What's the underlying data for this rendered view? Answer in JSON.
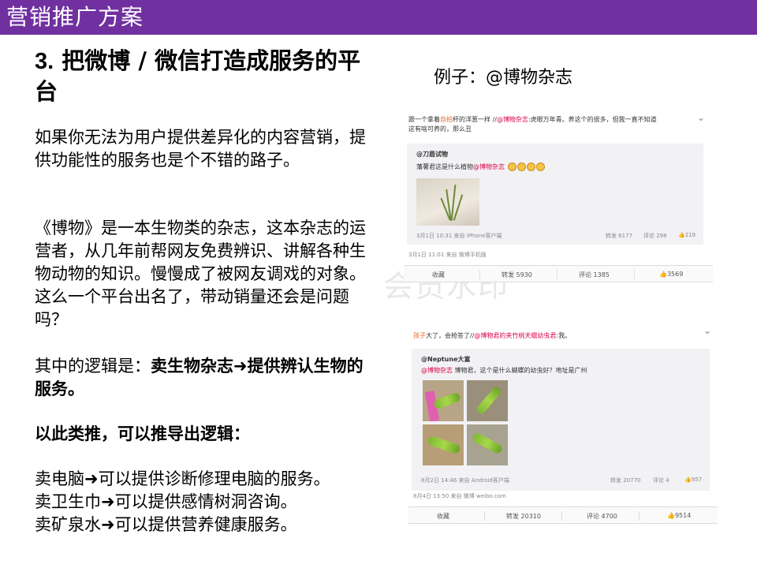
{
  "header": {
    "title": "营销推广方案"
  },
  "heading": {
    "num": "3.",
    "text": "把微博 / 微信打造成服务的平台"
  },
  "paragraphs": {
    "p1": "如果你无法为用户提供差异化的内容营销，提供功能性的服务也是个不错的路子。",
    "p2": "《博物》是一本生物类的杂志，这本杂志的运营者，从几年前帮网友免费辨识、讲解各种生物动物的知识。慢慢成了被网友调戏的对象。这么一个平台出名了，带动销量还会是问题吗？",
    "p3_prefix": "其中的逻辑是：",
    "p3_bold": "卖生物杂志➜提供辨认生物的服务。",
    "p4": "以此类推，可以推导出逻辑：",
    "p5_lines": [
      "卖电脑➜可以提供诊断修理电脑的服务。",
      "卖卫生巾➜可以提供感情树洞咨询。",
      "卖矿泉水➜可以提供营养健康服务。"
    ]
  },
  "example_label": "例子：@博物杂志",
  "watermark": "会员水印",
  "weibo1": {
    "post_pre": "跟一个拿着",
    "post_hl": "自拍",
    "post_mid": "杆的洋葱一样 //",
    "post_link": "@博物杂志",
    "post_rest": ":虎眼万年青。养这个的很多，但我一直不知道",
    "post_line2": "这有啥可养的，那么丑",
    "src_user": "@刀眉试物",
    "src_text_pre": "藩薯君这是什么植物",
    "src_text_link": "@博物杂志",
    "src_meta": "3月1日 10:31 来自 iPhone客户端",
    "src_stats": [
      "转发 6177",
      "评论 298",
      "👍218"
    ],
    "meta": "3月1日 11:01 来自 微博手机版",
    "actions": [
      "收藏",
      "转发 5930",
      "评论 1385",
      "👍3569"
    ]
  },
  "weibo2": {
    "post_hl": "孩子",
    "post_mid": "大了，会抢答了//",
    "post_link": "@博物君的夹竹桃天蛾幼虫君",
    "post_rest": ":我。",
    "src_user": "@Neptune大富",
    "src_text_link": "@博物杂志",
    "src_text_rest": "博物君，这个是什么蝴蝶的幼虫好？地址是广州",
    "src_meta": "8月2日 14:46 来自 Android客户端",
    "src_stats": [
      "转发 20770",
      "评论 4",
      "👍957"
    ],
    "meta": "8月4日 13:50 来自 微博 weibo.com",
    "actions": [
      "收藏",
      "转发 20310",
      "评论 4700",
      "👍9514"
    ]
  },
  "icons": {
    "chevron": "chevron-down-icon"
  },
  "colors": {
    "header_bg": "#7030a0",
    "header_text": "#ffffff",
    "link": "#dd0044"
  }
}
